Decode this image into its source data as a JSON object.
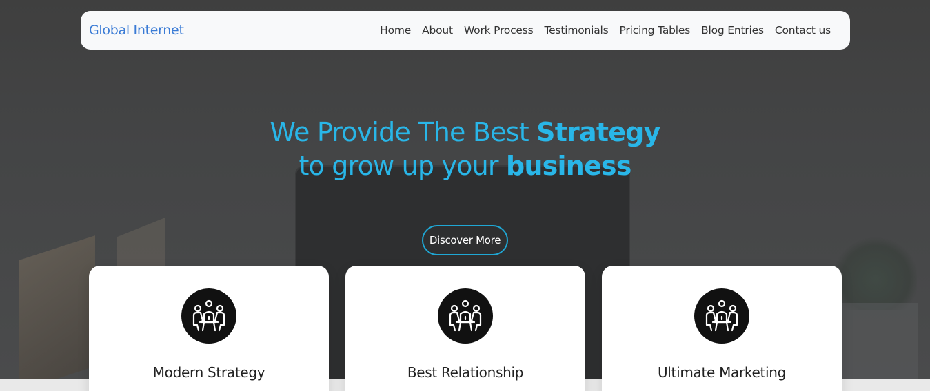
{
  "navbar": {
    "brand": "Global Internet",
    "links": [
      "Home",
      "About",
      "Work Process",
      "Testimonials",
      "Pricing Tables",
      "Blog Entries",
      "Contact us"
    ]
  },
  "hero": {
    "line1_regular": "We Provide The Best ",
    "line1_bold": "Strategy",
    "line2_regular": "to grow up your ",
    "line2_bold": "business",
    "button_label": "Discover More"
  },
  "cards": [
    {
      "title": "Modern Strategy",
      "icon": "team-meeting-icon"
    },
    {
      "title": "Best Relationship",
      "icon": "team-meeting-icon"
    },
    {
      "title": "Ultimate Marketing",
      "icon": "team-meeting-icon"
    }
  ],
  "colors": {
    "accent": "#29b6e8",
    "brand": "#3a7bd5",
    "button_border": "#1fa7d4",
    "navbar_bg": "#f8f9fa",
    "icon_bg": "#111111"
  }
}
